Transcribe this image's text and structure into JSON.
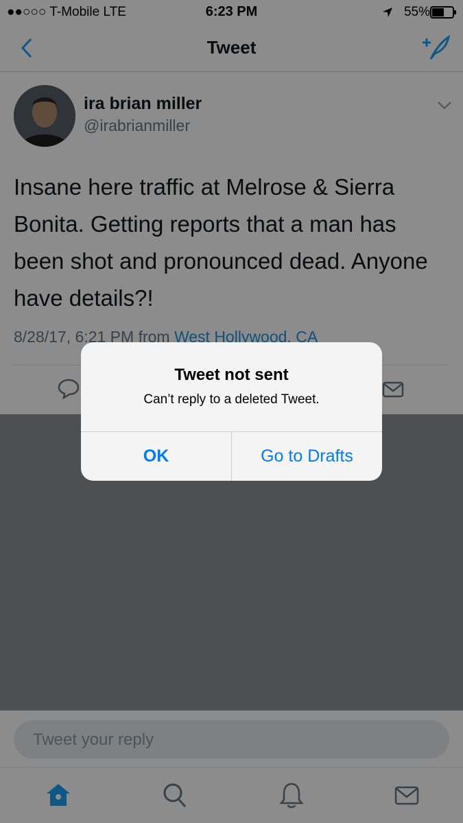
{
  "status_bar": {
    "carrier": "●●○○○ T-Mobile  LTE",
    "time": "6:23 PM",
    "battery": "55%"
  },
  "nav": {
    "title": "Tweet",
    "back_icon": "chevron-left-icon",
    "compose_icon": "compose-tweet-icon"
  },
  "tweet": {
    "display_name": "ira brian miller",
    "handle": "@irabrianmiller",
    "text": "Insane here traffic at Melrose & Sierra Bonita. Getting reports that a man has been shot and pronounced dead. Anyone have details?!",
    "timestamp": "8/28/17, 6:21 PM from ",
    "location": "West Hollywood, CA"
  },
  "alert": {
    "title": "Tweet not sent",
    "message": "Can’t reply to a deleted Tweet.",
    "ok_label": "OK",
    "drafts_label": "Go to Drafts"
  },
  "reply": {
    "placeholder": "Tweet your reply"
  },
  "tab_bar": {
    "items": [
      "home-icon",
      "search-icon",
      "notifications-icon",
      "messages-icon"
    ]
  },
  "colors": {
    "accent": "#1da1f2",
    "alert_button": "#007aff"
  }
}
